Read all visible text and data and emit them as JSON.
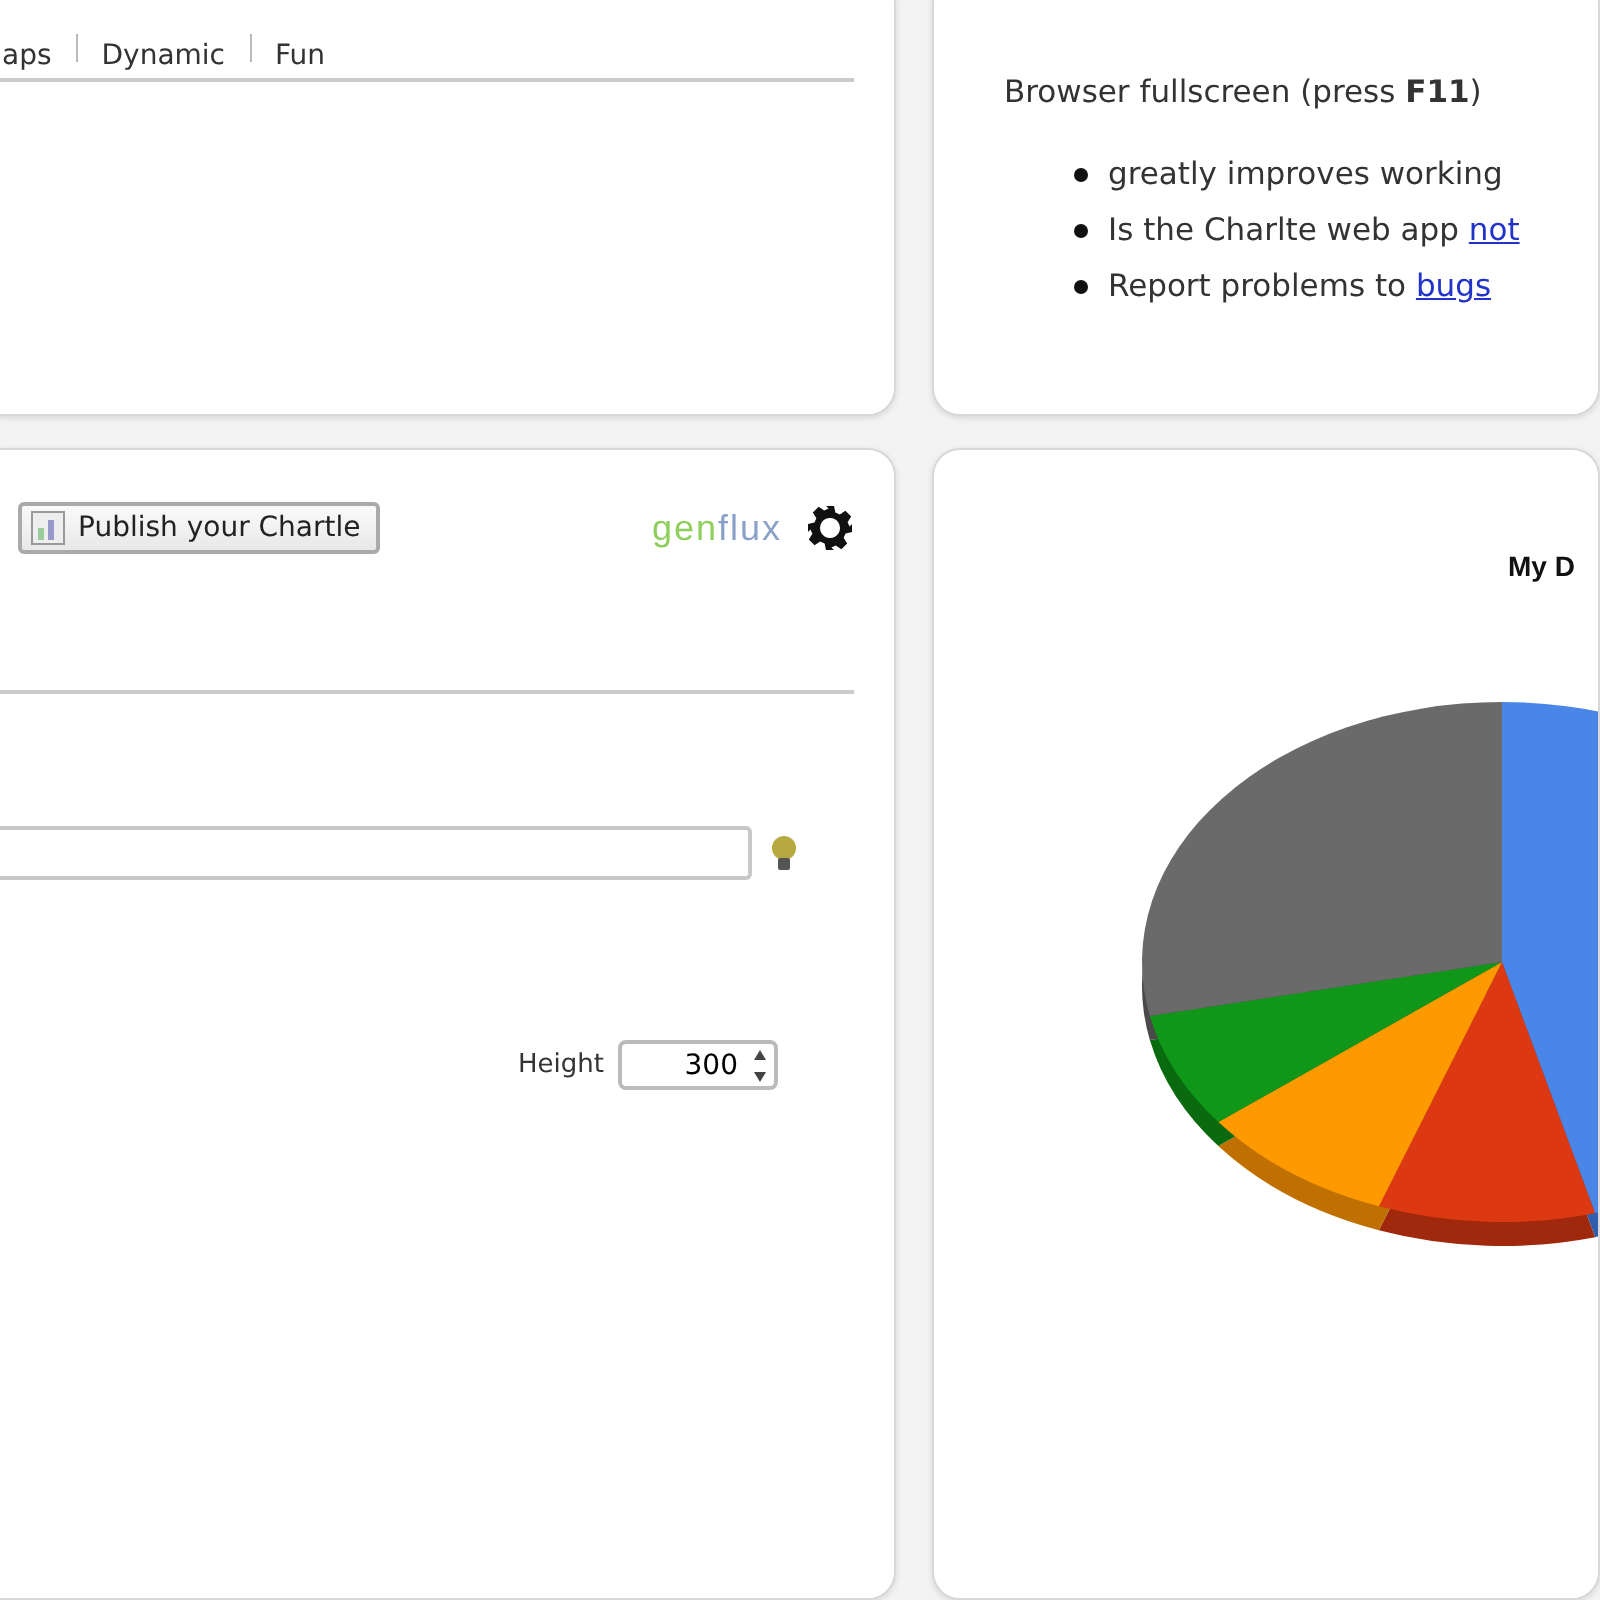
{
  "tabs_panel": {
    "tabs": [
      {
        "label": "aps",
        "selected": false
      },
      {
        "label": "Dynamic",
        "selected": false
      },
      {
        "label": "Fun",
        "selected": false
      }
    ]
  },
  "info_panel": {
    "heading": "Browser fullscreen (press **F11**)",
    "bullets": [
      {
        "text": "greatly improves working"
      },
      {
        "text": "Is the Charlte web app",
        "link": "not"
      },
      {
        "text": "Report problems to",
        "link": "bugs"
      }
    ]
  },
  "editor_panel": {
    "publish_button": "Publish your Chartle",
    "logo": [
      "gen",
      "flux"
    ],
    "height": {
      "label": "Height",
      "value": "300"
    }
  },
  "chart_panel": {
    "title": "My D"
  }
}
